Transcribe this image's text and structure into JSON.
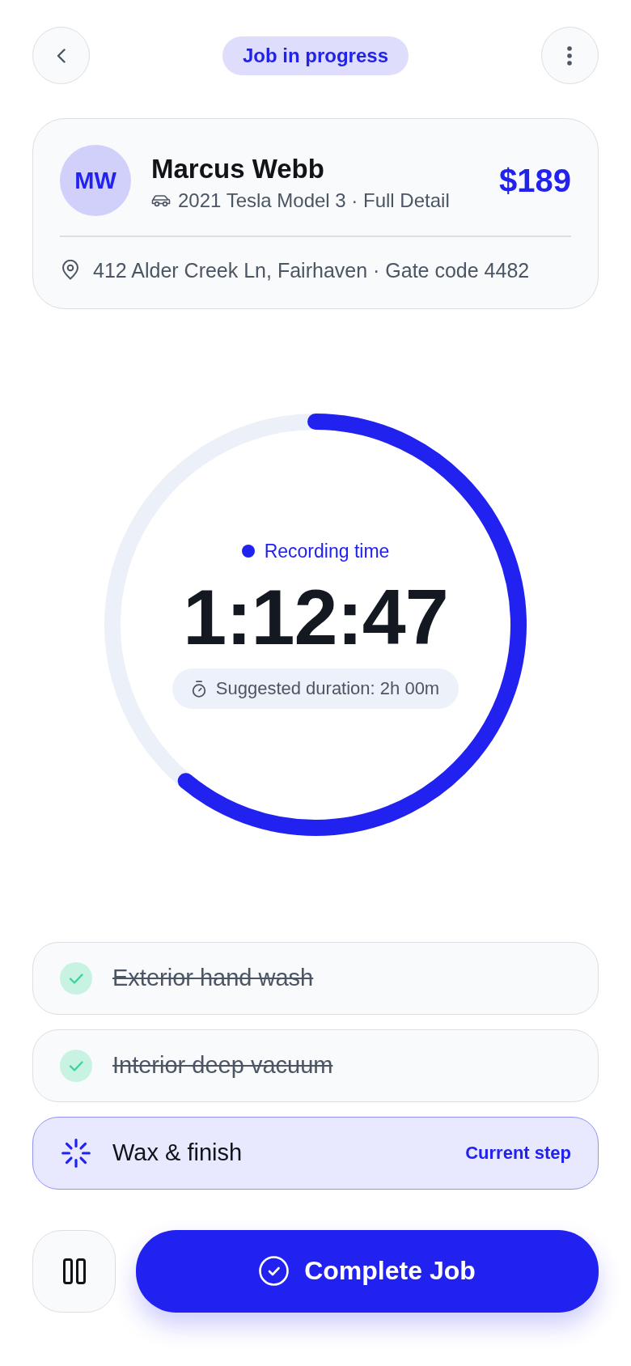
{
  "header": {
    "status": "Job in progress"
  },
  "customer": {
    "initials": "MW",
    "name": "Marcus Webb",
    "vehicle": "2021 Tesla Model 3 · Full Detail",
    "price": "$189",
    "address": "412 Alder Creek Ln, Fairhaven · Gate code 4482"
  },
  "timer": {
    "label": "Recording time",
    "elapsed": "1:12:47",
    "level": 0.61,
    "suggested": "Suggested duration: 2h 00m"
  },
  "steps": [
    {
      "label": "Exterior hand wash",
      "done": true,
      "current": false
    },
    {
      "label": "Interior deep vacuum",
      "done": true,
      "current": false
    },
    {
      "label": "Wax & finish",
      "done": false,
      "current": true,
      "tag": "Current step"
    }
  ],
  "actions": {
    "complete": "Complete Job"
  }
}
